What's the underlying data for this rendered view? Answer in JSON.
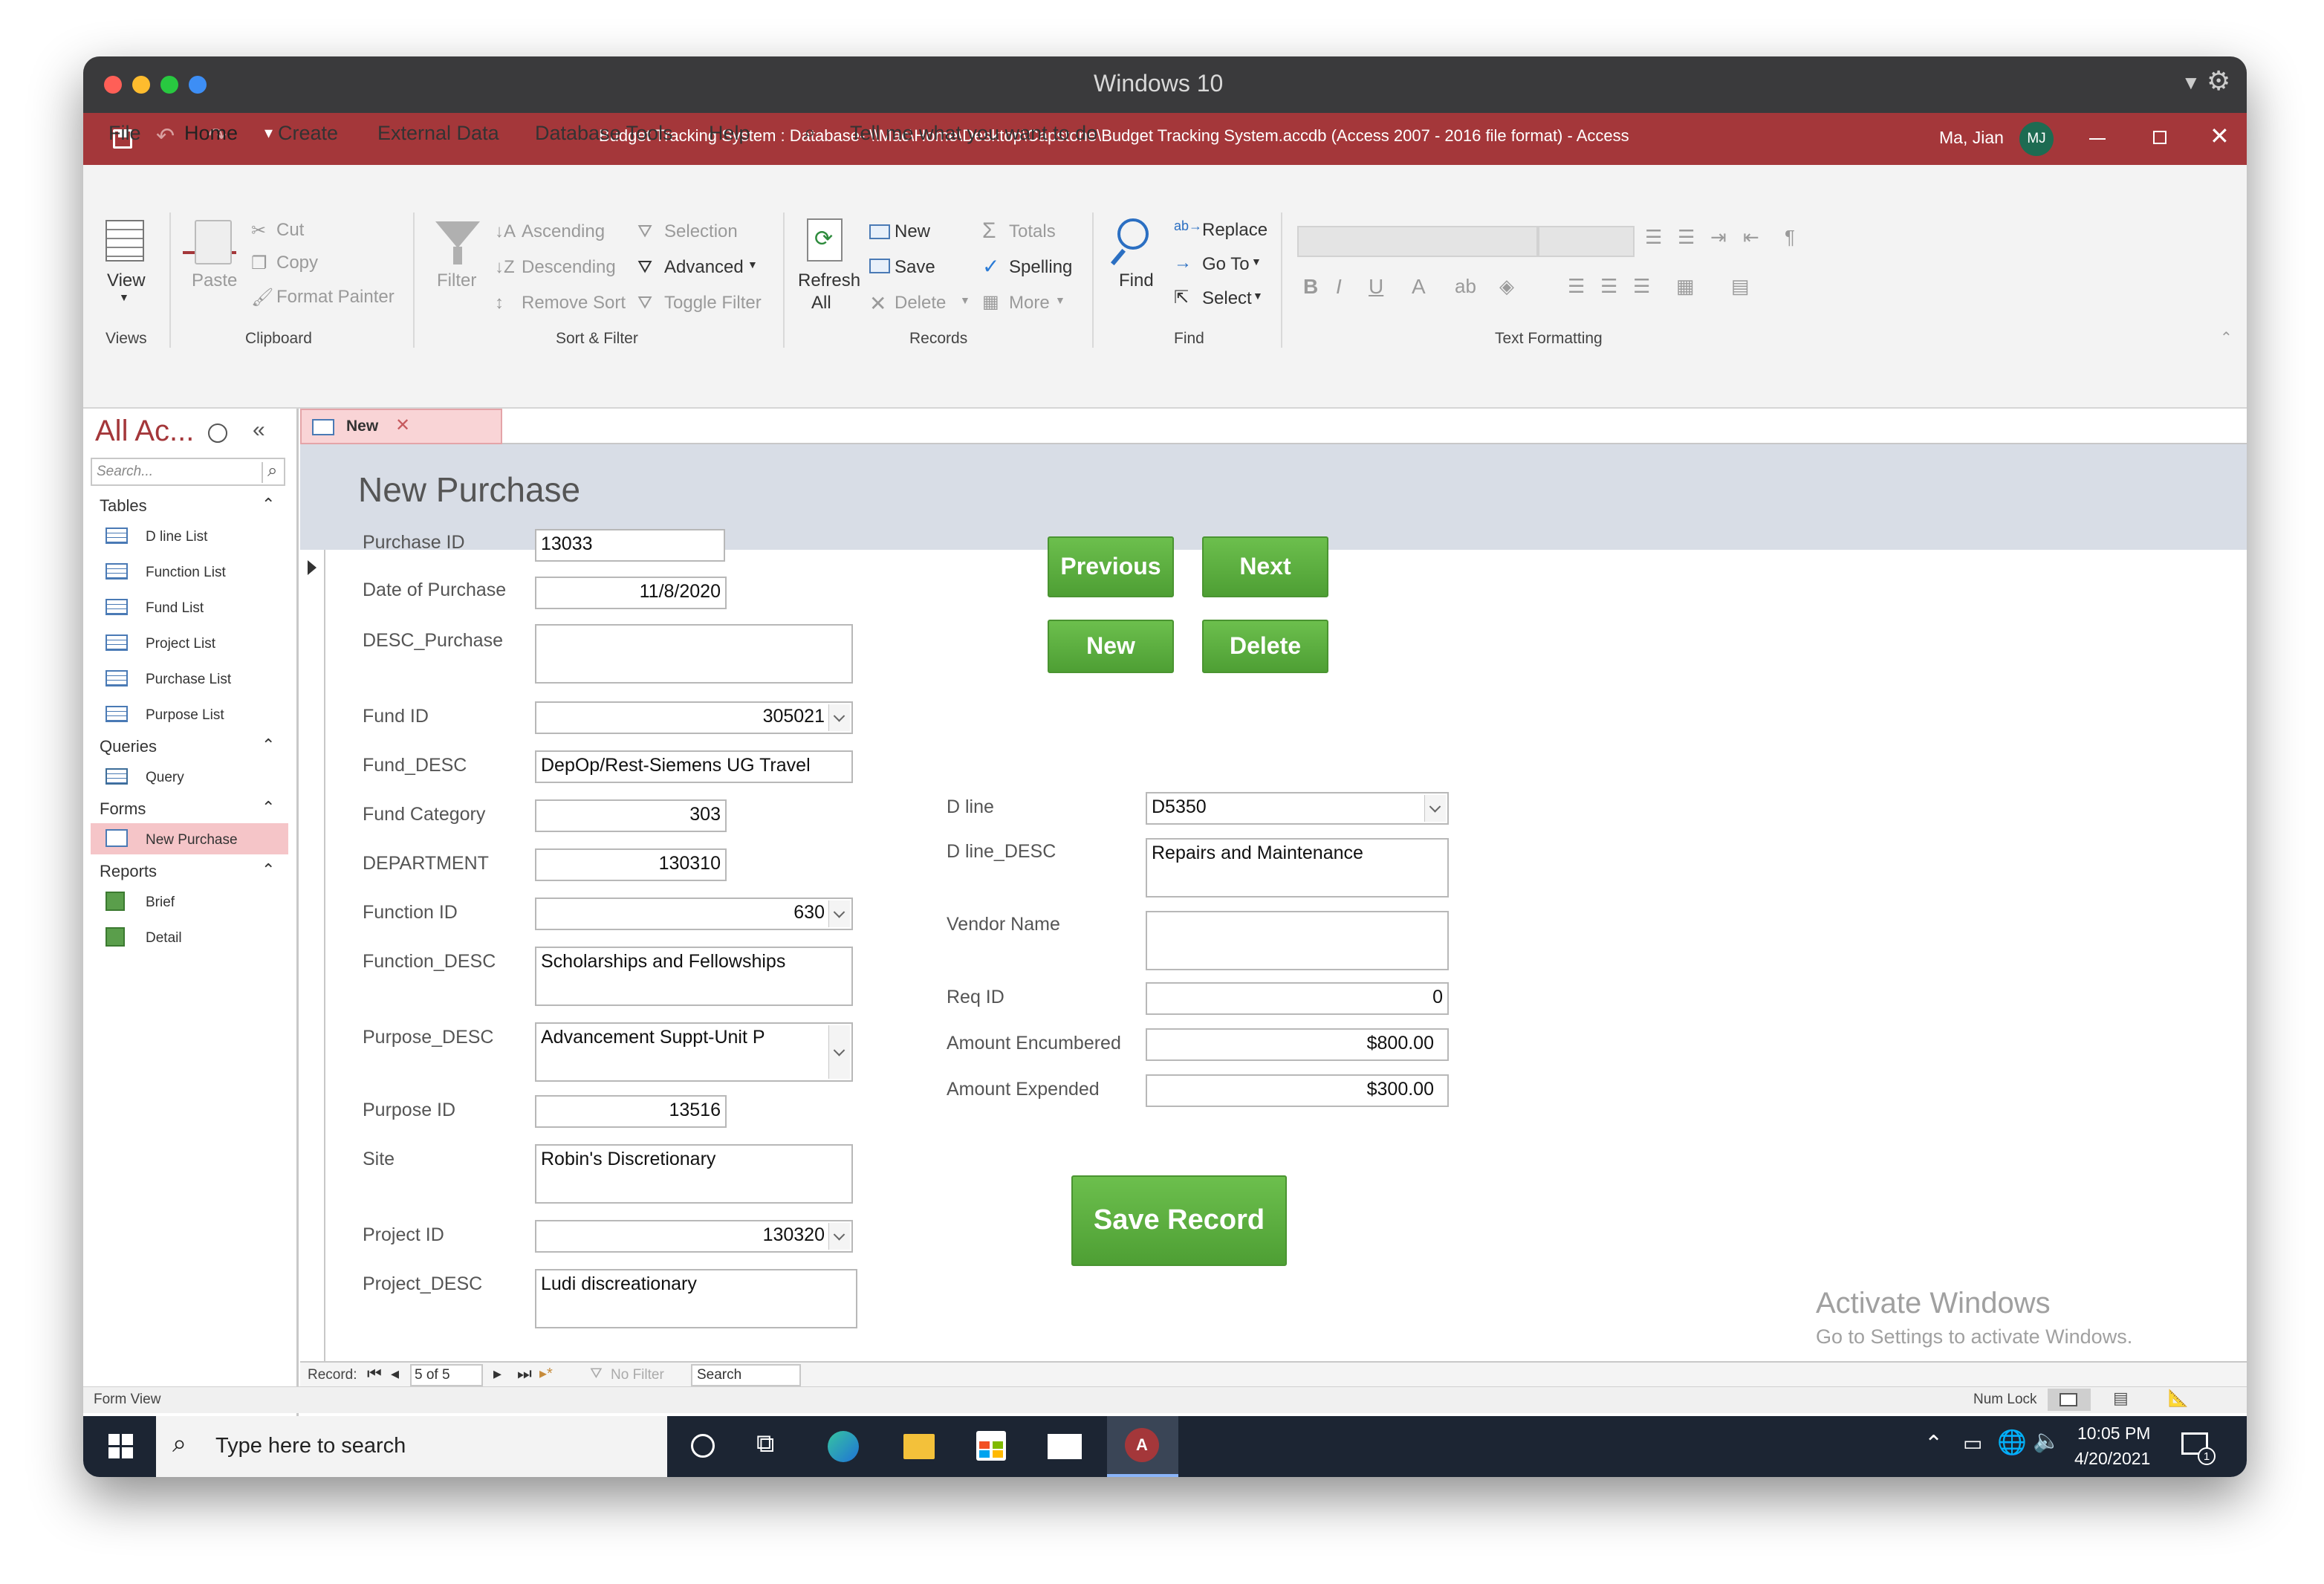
{
  "mac_window": {
    "title": "Windows 10"
  },
  "access_titlebar": {
    "title": "Budget Tracking System : Database- \\\\Mac\\Home\\Desktop\\Capstone\\Budget Tracking System.accdb (Access 2007 - 2016 file format)  -  Access",
    "user": "Ma, Jian",
    "avatar_initials": "MJ"
  },
  "menu_tabs": [
    "File",
    "Home",
    "Create",
    "External Data",
    "Database Tools",
    "Help"
  ],
  "tell_me": "Tell me what you want to do",
  "ribbon": {
    "views": {
      "view": "View",
      "group": "Views"
    },
    "clipboard": {
      "paste": "Paste",
      "cut": "Cut",
      "copy": "Copy",
      "format_painter": "Format Painter",
      "group": "Clipboard"
    },
    "sort_filter": {
      "filter": "Filter",
      "ascending": "Ascending",
      "descending": "Descending",
      "remove_sort": "Remove Sort",
      "selection": "Selection",
      "advanced": "Advanced",
      "toggle_filter": "Toggle Filter",
      "group": "Sort & Filter"
    },
    "records": {
      "refresh": "Refresh",
      "refresh_all": "All",
      "new": "New",
      "save": "Save",
      "delete": "Delete",
      "totals": "Totals",
      "spelling": "Spelling",
      "more": "More",
      "group": "Records"
    },
    "find": {
      "find": "Find",
      "replace": "Replace",
      "go_to": "Go To",
      "select": "Select",
      "group": "Find"
    },
    "text_formatting": {
      "bold": "B",
      "italic": "I",
      "underline": "U",
      "font_color": "A",
      "group": "Text Formatting"
    }
  },
  "nav_pane": {
    "title": "All Ac...",
    "search_placeholder": "Search...",
    "sections": [
      {
        "name": "Tables",
        "items": [
          "D line List",
          "Function List",
          "Fund List",
          "Project List",
          "Purchase List",
          "Purpose List"
        ]
      },
      {
        "name": "Queries",
        "items": [
          "Query"
        ]
      },
      {
        "name": "Forms",
        "items": [
          "New Purchase"
        ]
      },
      {
        "name": "Reports",
        "items": [
          "Brief",
          "Detail"
        ]
      }
    ]
  },
  "doc_tab": {
    "label": "New"
  },
  "form": {
    "title": "New Purchase",
    "left_fields": [
      {
        "label": "Purchase ID",
        "value": "13033"
      },
      {
        "label": "Date of Purchase",
        "value": "11/8/2020"
      },
      {
        "label": "DESC_Purchase",
        "value": ""
      },
      {
        "label": "Fund ID",
        "value": "305021"
      },
      {
        "label": "Fund_DESC",
        "value": "DepOp/Rest-Siemens UG Travel"
      },
      {
        "label": "Fund Category",
        "value": "303"
      },
      {
        "label": "DEPARTMENT",
        "value": "130310"
      },
      {
        "label": "Function ID",
        "value": "630"
      },
      {
        "label": "Function_DESC",
        "value": "Scholarships and Fellowships"
      },
      {
        "label": "Purpose_DESC",
        "value": "Advancement Suppt-Unit P"
      },
      {
        "label": "Purpose ID",
        "value": "13516"
      },
      {
        "label": "Site",
        "value": "Robin's Discretionary"
      },
      {
        "label": "Project ID",
        "value": "130320"
      },
      {
        "label": "Project_DESC",
        "value": "Ludi discreationary"
      }
    ],
    "right_fields": [
      {
        "label": "D line",
        "value": "D5350"
      },
      {
        "label": "D line_DESC",
        "value": "Repairs and Maintenance"
      },
      {
        "label": "Vendor Name",
        "value": ""
      },
      {
        "label": "Req ID",
        "value": "0"
      },
      {
        "label": "Amount Encumbered",
        "value": "$800.00"
      },
      {
        "label": "Amount Expended",
        "value": "$300.00"
      }
    ],
    "buttons": {
      "previous": "Previous",
      "next": "Next",
      "new": "New",
      "delete": "Delete",
      "save_record": "Save Record"
    }
  },
  "record_nav": {
    "label": "Record:",
    "position": "5 of 5",
    "filter": "No Filter",
    "search": "Search"
  },
  "watermark": {
    "line1": "Activate Windows",
    "line2": "Go to Settings to activate Windows."
  },
  "statusbar": {
    "view": "Form View",
    "num_lock": "Num Lock"
  },
  "taskbar": {
    "search_placeholder": "Type here to search",
    "time": "10:05 PM",
    "date": "4/20/2021",
    "notifications": "1"
  },
  "colors": {
    "access_red": "#a4373a",
    "button_green": "#5cad3f",
    "header_band": "#d8dde6",
    "taskbar": "#1c2533"
  }
}
